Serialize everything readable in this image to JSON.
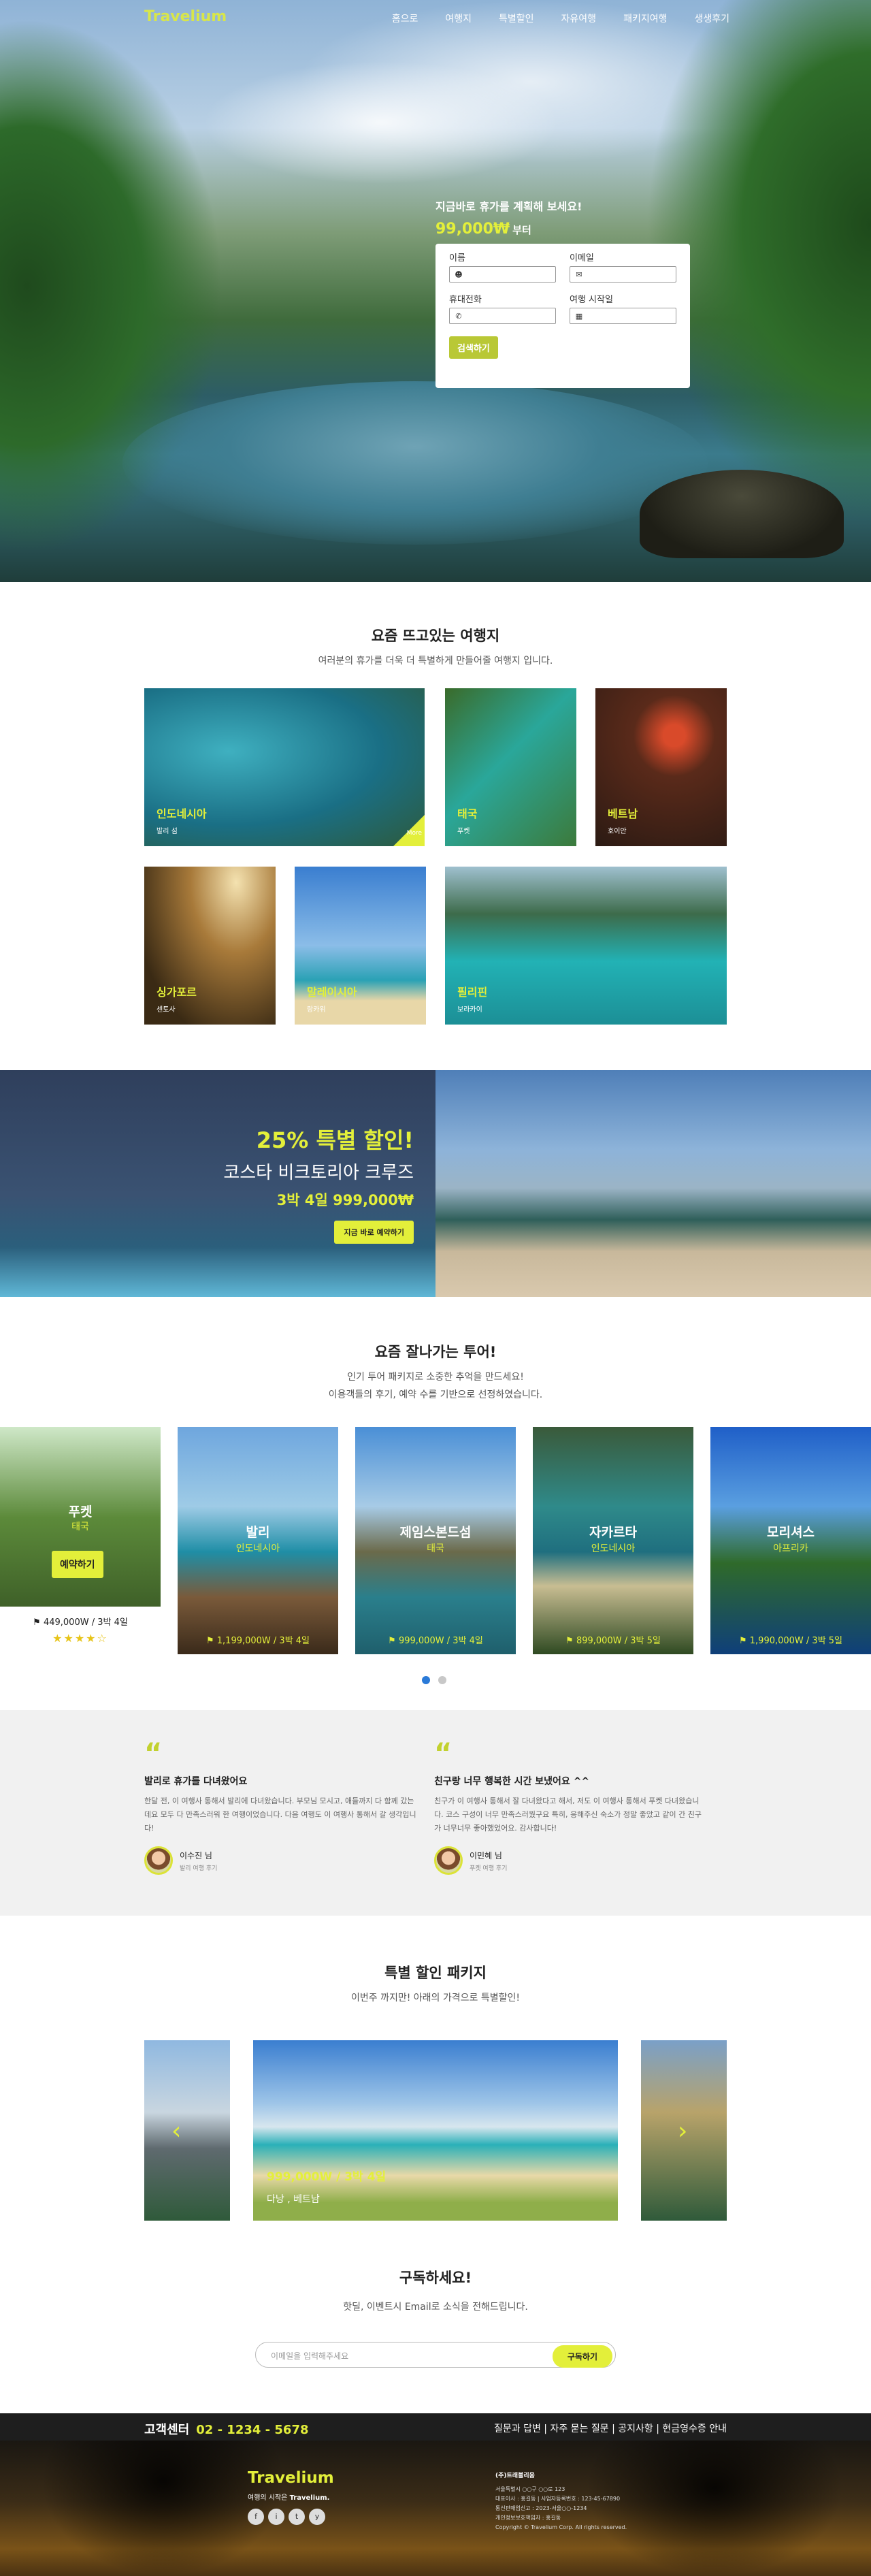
{
  "brand": {
    "logo": "Travelium",
    "accent": "#e3ef3a"
  },
  "nav": {
    "items": [
      "홈으로",
      "여행지",
      "특별할인",
      "자유여행",
      "패키지여행",
      "생생후기"
    ]
  },
  "hero": {
    "title": "지금바로 휴가를 계획해 보세요!",
    "price": "99,000₩",
    "price_suffix": "부터",
    "form": {
      "name_label": "이름",
      "email_label": "이메일",
      "phone_label": "휴대전화",
      "date_label": "여행 시작일",
      "name_icon": "user-icon",
      "email_icon": "mail-icon",
      "phone_icon": "phone-icon",
      "date_icon": "calendar-icon",
      "search_button": "검색하기"
    }
  },
  "popular": {
    "title": "요즘 뜨고있는 여행지",
    "subtitle": "여러분의 휴가를 더욱 더 특별하게 만들어줄 여행지 입니다.",
    "destinations": [
      {
        "name": "인도네시아",
        "sub": "발리 섬",
        "badge": "More"
      },
      {
        "name": "태국",
        "sub": "푸켓"
      },
      {
        "name": "베트남",
        "sub": "호이안"
      },
      {
        "name": "싱가포르",
        "sub": "센토사"
      },
      {
        "name": "말레이시아",
        "sub": "랑카위"
      },
      {
        "name": "필리핀",
        "sub": "보라카이"
      }
    ]
  },
  "promo": {
    "headline": "25% 특별 할인!",
    "title": "코스타 비크토리아 크루즈",
    "price": "3박 4일 999,000₩",
    "button": "지금 바로 예약하기"
  },
  "tours": {
    "title": "요즘 잘나가는 투어!",
    "subtitle_1": "인기 투어 패키지로 소중한 추억을 만드세요!",
    "subtitle_2": "이용객들의 후기, 예약 수를 기반으로 선정하였습니다.",
    "cards": [
      {
        "name": "푸켓",
        "sub": "태국",
        "price": "449,000W / 3박 4일",
        "book": "예약하기",
        "stars": "★★★★☆",
        "price_icon": "tag-icon"
      },
      {
        "name": "발리",
        "sub": "인도네시아",
        "price": "1,199,000W / 3박 4일",
        "price_icon": "tag-icon"
      },
      {
        "name": "제임스본드섬",
        "sub": "태국",
        "price": "999,000W / 3박 4일",
        "price_icon": "tag-icon"
      },
      {
        "name": "자카르타",
        "sub": "인도네시아",
        "price": "899,000W / 3박 5일",
        "price_icon": "tag-icon"
      },
      {
        "name": "모리셔스",
        "sub": "아프리카",
        "price": "1,990,000W / 3박 5일",
        "price_icon": "tag-icon"
      }
    ],
    "active_page": 1,
    "page_count": 2
  },
  "reviews": [
    {
      "title": "발리로 휴가를 다녀왔어요",
      "body": "한달 전, 이 여행사 통해서 발리에 다녀왔습니다. 부모님 모시고, 애들까지 다 함께 갔는데요 모두 다 만족스러워 한 여행이었습니다. 다음 여행도 이 여행사 통해서 갈 생각입니다!",
      "author": "이수진 님",
      "author_sub": "발리 여행 후기"
    },
    {
      "title": "친구랑 너무 행복한 시간 보냈어요 ^^",
      "body": "친구가 이 여행사 통해서 잘 다녀왔다고 해서, 저도 이 여행사 통해서 푸켓 다녀왔습니다. 코스 구성이 너무 만족스러웠구요 특히, 응해주신 숙소가 정말 좋았고 같이 간 친구가 너무너무 좋아했었어요. 감사합니다!",
      "author": "이민혜 님",
      "author_sub": "푸켓 여행 후기"
    }
  ],
  "special": {
    "title": "특별 할인 패키지",
    "subtitle": "이번주 까지만! 아래의 가격으로 특별할인!",
    "slide_price": "999,000W / 3박 4일",
    "slide_place": "다낭 , 베트남"
  },
  "subscribe": {
    "title": "구독하세요!",
    "subtitle": "핫딜, 이벤트시 Email로 소식을 전해드립니다.",
    "placeholder": "이메일을 입력해주세요",
    "button": "구독하기"
  },
  "footer": {
    "cs_label": "고객센터",
    "cs_phone": "02 - 1234 - 5678",
    "links": "질문과 답변 | 자주 묻는 질문 | 공지사항 | 현금영수증 안내",
    "logo": "Travelium",
    "tagline_1": "여행의 시작은",
    "tagline_2": "Travelium.",
    "social": [
      "f",
      "i",
      "t",
      "y"
    ],
    "company": "(주)트래블리움",
    "info_1": "서울특별시 ○○구 ○○로 123",
    "info_2": "대표이사 : 홍길동 | 사업자등록번호 : 123-45-67890",
    "info_3": "통신판매업신고 : 2023-서울○○-1234",
    "info_4": "개인정보보호책임자 : 홍길동",
    "info_5": "Copyright © Travelium Corp. All rights reserved."
  }
}
